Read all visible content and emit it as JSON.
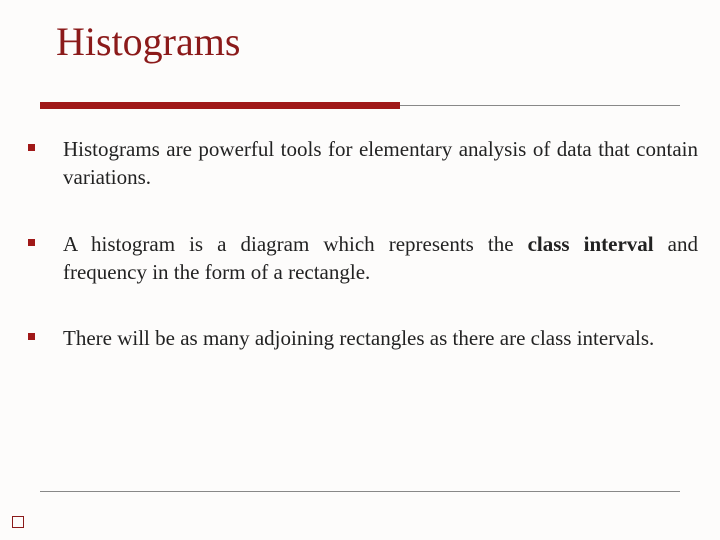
{
  "title": "Histograms",
  "bullets": [
    {
      "text_before": "Histograms are powerful tools for elementary analysis of data that contain variations.",
      "bold": "",
      "text_after": ""
    },
    {
      "text_before": "A histogram is a diagram which represents the ",
      "bold": "class interval",
      "text_after": " and frequency in the form of a rectangle."
    },
    {
      "text_before": "There will be as many adjoining rectangles as there are class intervals.",
      "bold": "",
      "text_after": ""
    }
  ]
}
